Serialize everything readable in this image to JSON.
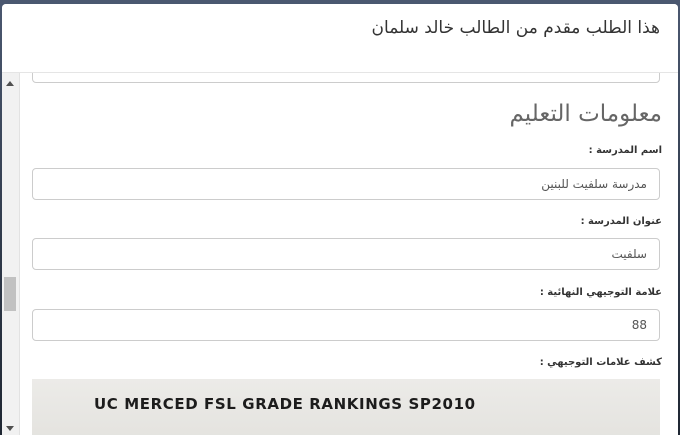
{
  "modal": {
    "title": "هذا الطلب مقدم من الطالب خالد سلمان"
  },
  "section": {
    "heading": "معلومات التعليم"
  },
  "fields": [
    {
      "label": "اسم المدرسة :",
      "value": "مدرسة سلفيت للبنين"
    },
    {
      "label": "عنوان المدرسة :",
      "value": "سلفيت"
    },
    {
      "label": "علامة التوجيهي النهائية :",
      "value": "88"
    }
  ],
  "transcript": {
    "label": "كشف علامات التوجيهي :",
    "image_text": "UC MERCED FSL GRADE RANKINGS SP2010"
  }
}
